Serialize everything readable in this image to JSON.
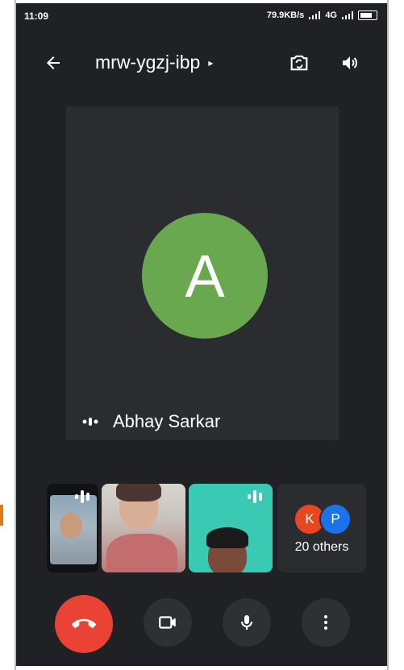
{
  "status_bar": {
    "time": "11:09",
    "speed": "79.9KB/s",
    "signal": "4G"
  },
  "header": {
    "meeting_code": "mrw-ygzj-ibp",
    "caret": "▸"
  },
  "main_tile": {
    "avatar_letter": "A",
    "avatar_color": "#6aa84f",
    "participant_name": "Abhay Sarkar"
  },
  "others_tile": {
    "avatar_1_letter": "K",
    "avatar_1_color": "#e8461e",
    "avatar_2_letter": "P",
    "avatar_2_color": "#1a73e8",
    "label": "20 others"
  },
  "controls": {
    "end_call_color": "#ea4335",
    "icons": [
      "end-call-icon",
      "camera-icon",
      "mic-icon",
      "more-vert-icon"
    ]
  }
}
